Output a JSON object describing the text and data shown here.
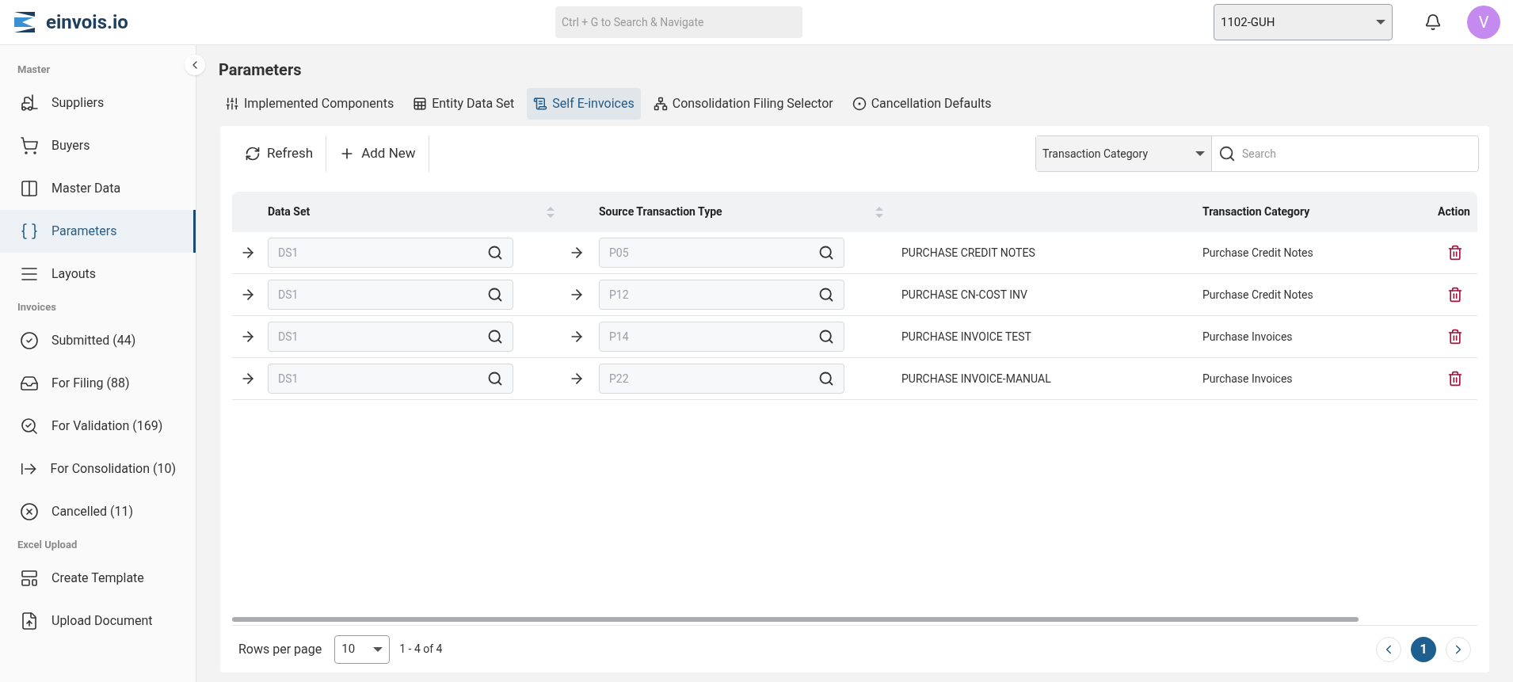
{
  "brand": "einvois.io",
  "global_search": {
    "placeholder": "Ctrl + G to Search & Navigate"
  },
  "company_select": {
    "value": "1102-GUH"
  },
  "avatar": {
    "initial": "V"
  },
  "sidebar": [
    {
      "heading": "Master",
      "items": [
        {
          "label": "Suppliers",
          "selected": false
        },
        {
          "label": "Buyers",
          "selected": false
        },
        {
          "label": "Master Data",
          "selected": false
        },
        {
          "label": "Parameters",
          "selected": true
        },
        {
          "label": "Layouts",
          "selected": false
        }
      ]
    },
    {
      "heading": "Invoices",
      "items": [
        {
          "label": "Submitted (44)",
          "selected": false
        },
        {
          "label": "For Filing (88)",
          "selected": false
        },
        {
          "label": "For Validation (169)",
          "selected": false
        },
        {
          "label": "For Consolidation (10)",
          "selected": false
        },
        {
          "label": "Cancelled (11)",
          "selected": false
        }
      ]
    },
    {
      "heading": "Excel Upload",
      "items": [
        {
          "label": "Create Template",
          "selected": false
        },
        {
          "label": "Upload Document",
          "selected": false
        }
      ]
    }
  ],
  "page_title": "Parameters",
  "tabs": [
    {
      "label": "Implemented Components",
      "selected": false
    },
    {
      "label": "Entity Data Set",
      "selected": false
    },
    {
      "label": "Self E-invoices",
      "selected": true
    },
    {
      "label": "Consolidation Filing Selector",
      "selected": false
    },
    {
      "label": "Cancellation Defaults",
      "selected": false
    }
  ],
  "toolbar": {
    "refresh": "Refresh",
    "add_new": "Add New",
    "filter_field": "Transaction Category",
    "search_placeholder": "Search"
  },
  "table": {
    "columns": [
      "Data Set",
      "Source Transaction Type",
      "Transaction Category",
      "Action"
    ],
    "rows": [
      {
        "data_set": "DS1",
        "source_type": "P05",
        "description": "PURCHASE CREDIT NOTES",
        "category": "Purchase Credit Notes"
      },
      {
        "data_set": "DS1",
        "source_type": "P12",
        "description": "PURCHASE CN-COST INV",
        "category": "Purchase Credit Notes"
      },
      {
        "data_set": "DS1",
        "source_type": "P14",
        "description": "PURCHASE INVOICE TEST",
        "category": "Purchase Invoices"
      },
      {
        "data_set": "DS1",
        "source_type": "P22",
        "description": "PURCHASE INVOICE-MANUAL",
        "category": "Purchase Invoices"
      }
    ]
  },
  "pagination": {
    "rows_per_page_label": "Rows per page",
    "rows_per_page": "10",
    "range": "1 - 4 of 4",
    "pages": [
      {
        "label": "1",
        "selected": true
      }
    ]
  }
}
